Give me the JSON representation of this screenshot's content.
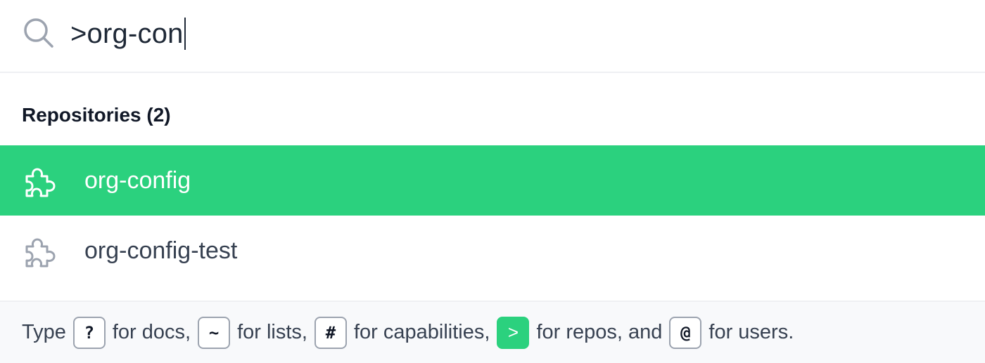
{
  "search": {
    "value": ">org-con",
    "icon": "search-icon"
  },
  "section": {
    "title": "Repositories (2)"
  },
  "results": [
    {
      "label": "org-config",
      "icon": "puzzle-icon",
      "selected": true
    },
    {
      "label": "org-config-test",
      "icon": "puzzle-icon",
      "selected": false
    }
  ],
  "footer": {
    "prefix": "Type",
    "hints": [
      {
        "key": "?",
        "text": "for docs,",
        "active": false
      },
      {
        "key": "~",
        "text": "for lists,",
        "active": false
      },
      {
        "key": "#",
        "text": "for capabilities,",
        "active": false
      },
      {
        "key": ">",
        "text": "for repos, and",
        "active": true
      },
      {
        "key": "@",
        "text": "for users.",
        "active": false
      }
    ]
  },
  "colors": {
    "accent": "#2bd17e",
    "text": "#374151",
    "heading": "#111827",
    "footer_bg": "#f8f9fb",
    "icon_gray": "#9ca3af"
  }
}
